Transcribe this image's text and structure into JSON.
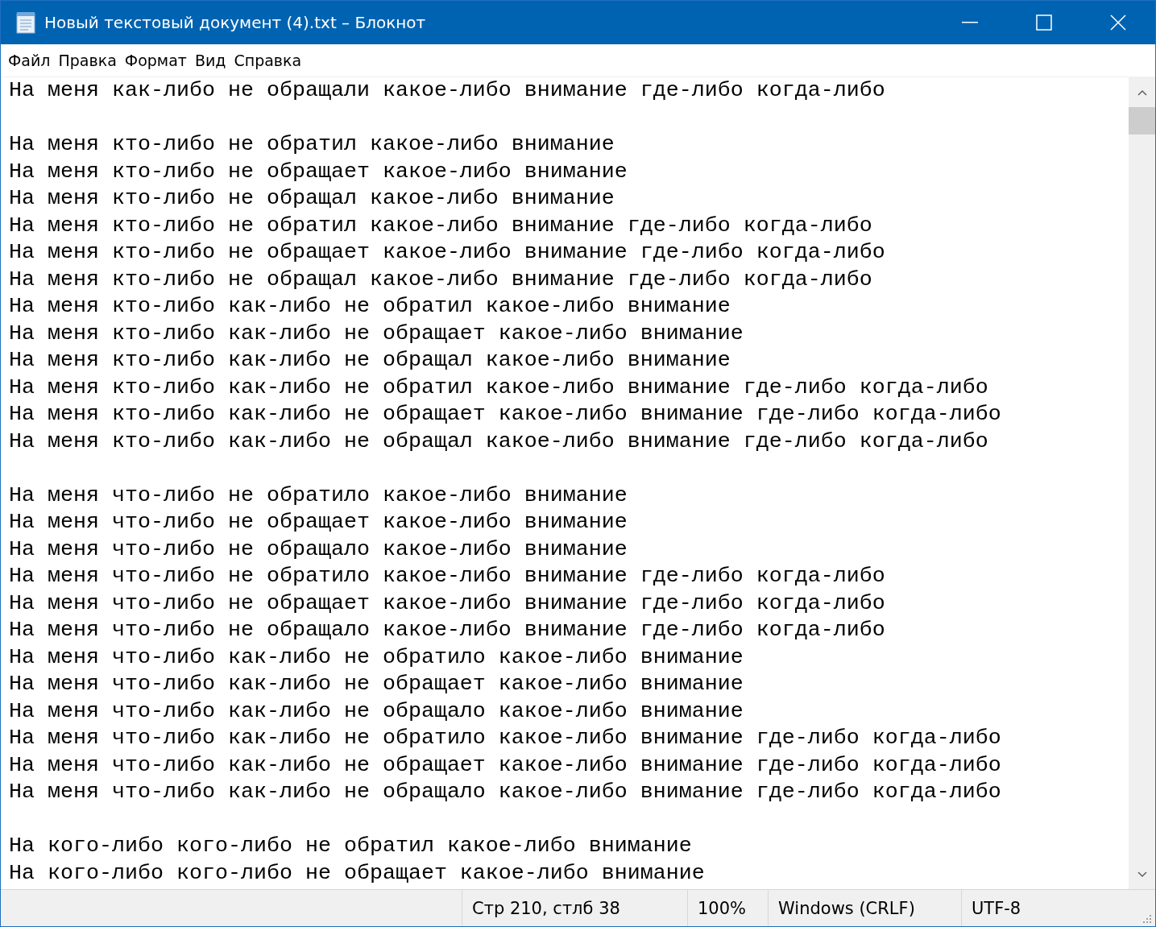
{
  "window": {
    "title": "Новый текстовый документ (4).txt – Блокнот"
  },
  "menu": [
    "Файл",
    "Правка",
    "Формат",
    "Вид",
    "Справка"
  ],
  "document": {
    "blocks": [
      [
        "На меня как-либо не обращали какое-либо внимание где-либо когда-либо"
      ],
      [
        "На меня кто-либо не обратил какое-либо внимание",
        "На меня кто-либо не обращает какое-либо внимание",
        "На меня кто-либо не обращал какое-либо внимание",
        "На меня кто-либо не обратил какое-либо внимание где-либо когда-либо",
        "На меня кто-либо не обращает какое-либо внимание где-либо когда-либо",
        "На меня кто-либо не обращал какое-либо внимание где-либо когда-либо",
        "На меня кто-либо как-либо не обратил какое-либо внимание",
        "На меня кто-либо как-либо не обращает какое-либо внимание",
        "На меня кто-либо как-либо не обращал какое-либо внимание",
        "На меня кто-либо как-либо не обратил какое-либо внимание где-либо когда-либо",
        "На меня кто-либо как-либо не обращает какое-либо внимание где-либо когда-либо",
        "На меня кто-либо как-либо не обращал какое-либо внимание где-либо когда-либо"
      ],
      [
        "На меня что-либо не обратило какое-либо внимание",
        "На меня что-либо не обращает какое-либо внимание",
        "На меня что-либо не обращало какое-либо внимание",
        "На меня что-либо не обратило какое-либо внимание где-либо когда-либо",
        "На меня что-либо не обращает какое-либо внимание где-либо когда-либо",
        "На меня что-либо не обращало какое-либо внимание где-либо когда-либо",
        "На меня что-либо как-либо не обратило какое-либо внимание",
        "На меня что-либо как-либо не обращает какое-либо внимание",
        "На меня что-либо как-либо не обращало какое-либо внимание",
        "На меня что-либо как-либо не обратило какое-либо внимание где-либо когда-либо",
        "На меня что-либо как-либо не обращает какое-либо внимание где-либо когда-либо",
        "На меня что-либо как-либо не обращало какое-либо внимание где-либо когда-либо"
      ],
      [
        "На кого-либо кого-либо не обратил какое-либо внимание",
        "На кого-либо кого-либо не обращает какое-либо внимание"
      ]
    ]
  },
  "status_bar": {
    "position": "Стр 210, стлб 38",
    "zoom": "100%",
    "line_endings": "Windows (CRLF)",
    "encoding": "UTF-8"
  }
}
